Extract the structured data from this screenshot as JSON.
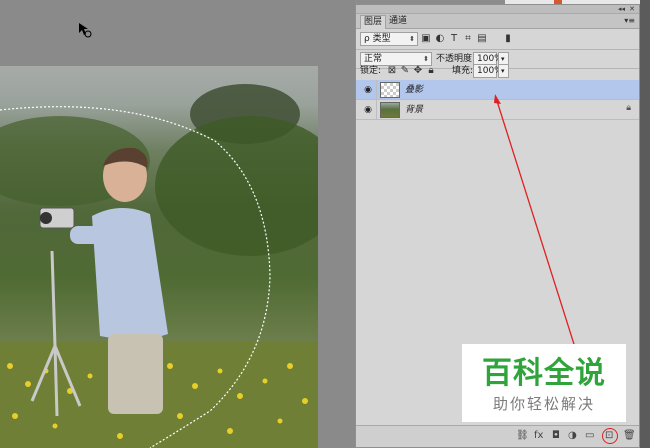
{
  "panel": {
    "tabs": [
      {
        "label": "图层",
        "active": true
      },
      {
        "label": "通道",
        "active": false
      }
    ],
    "filter_kind": "ρ 类型",
    "blend_mode": "正常",
    "opacity_label": "不透明度:",
    "opacity_value": "100%",
    "lock_label": "锁定:",
    "fill_label": "填充:",
    "fill_value": "100%",
    "layers": [
      {
        "name": "叠影",
        "selected": true,
        "thumb": "transparent",
        "locked": false
      },
      {
        "name": "背景",
        "selected": false,
        "thumb": "photo",
        "locked": true
      }
    ]
  },
  "watermark": {
    "title": "百科全说",
    "subtitle": "助你轻松解决"
  },
  "colors": {
    "selection_blue": "#b3c7ec",
    "annotation_red": "#e02020",
    "watermark_green": "#2fa43a",
    "panel_bg": "#d6d6d6"
  },
  "icons": [
    "eye-icon",
    "lock-icon",
    "move-icon",
    "brush-icon",
    "type-icon",
    "new-layer-icon",
    "trash-icon",
    "cursor-icon"
  ]
}
